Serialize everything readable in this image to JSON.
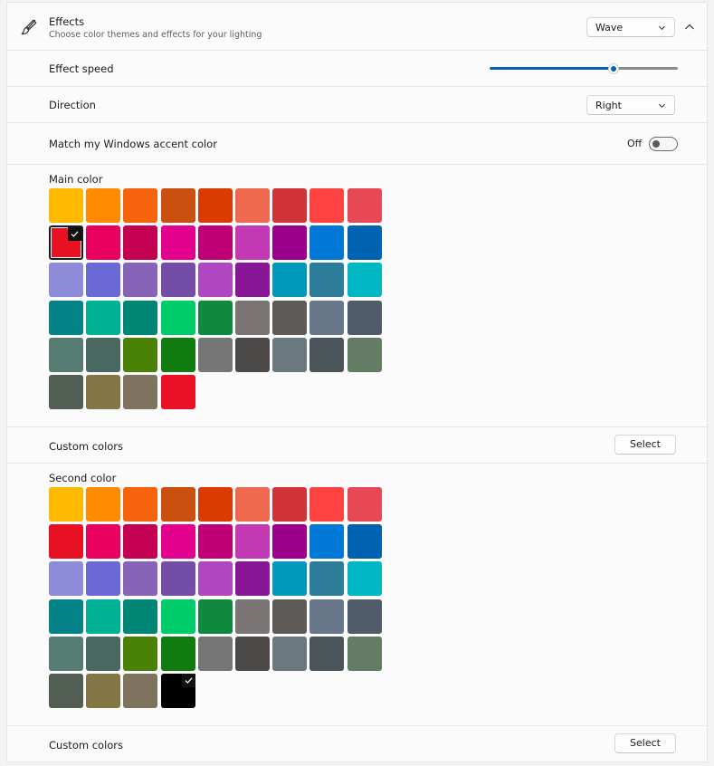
{
  "effects": {
    "title": "Effects",
    "subtitle": "Choose color themes and effects for your lighting",
    "icon": "brush-icon",
    "selected_effect": "Wave"
  },
  "effect_speed": {
    "label": "Effect speed",
    "value": 0.66,
    "accent": "#0a5fb3"
  },
  "direction": {
    "label": "Direction",
    "value": "Right"
  },
  "accent_match": {
    "label": "Match my Windows accent color",
    "state_text": "Off",
    "on": false
  },
  "main_color": {
    "label": "Main color",
    "selected_index": 9,
    "colors": [
      "#ffb900",
      "#ff8c00",
      "#f7630c",
      "#ca5010",
      "#da3b01",
      "#ef6950",
      "#d13438",
      "#ff4343",
      "#e74856",
      "#e81123",
      "#ea005e",
      "#c30052",
      "#e3008c",
      "#bf0077",
      "#c239b3",
      "#9a0089",
      "#0078d7",
      "#0063b1",
      "#8e8cd8",
      "#6b69d6",
      "#8764b8",
      "#744da9",
      "#b146c2",
      "#881798",
      "#0099bc",
      "#2d7d9a",
      "#00b7c3",
      "#038387",
      "#00b294",
      "#018574",
      "#00cc6a",
      "#10893e",
      "#7a7574",
      "#5d5a58",
      "#68768a",
      "#515c6b",
      "#567c73",
      "#486860",
      "#498205",
      "#107c10",
      "#767676",
      "#4c4a48",
      "#69797e",
      "#4a5459",
      "#647c64",
      "#525e54",
      "#847545",
      "#7e735f",
      "#ea1126"
    ]
  },
  "main_custom": {
    "label": "Custom colors",
    "button": "Select"
  },
  "second_color": {
    "label": "Second color",
    "selected_index": 48,
    "colors": [
      "#ffb900",
      "#ff8c00",
      "#f7630c",
      "#ca5010",
      "#da3b01",
      "#ef6950",
      "#d13438",
      "#ff4343",
      "#e74856",
      "#e81123",
      "#ea005e",
      "#c30052",
      "#e3008c",
      "#bf0077",
      "#c239b3",
      "#9a0089",
      "#0078d7",
      "#0063b1",
      "#8e8cd8",
      "#6b69d6",
      "#8764b8",
      "#744da9",
      "#b146c2",
      "#881798",
      "#0099bc",
      "#2d7d9a",
      "#00b7c3",
      "#038387",
      "#00b294",
      "#018574",
      "#00cc6a",
      "#10893e",
      "#7a7574",
      "#5d5a58",
      "#68768a",
      "#515c6b",
      "#567c73",
      "#486860",
      "#498205",
      "#107c10",
      "#767676",
      "#4c4a48",
      "#69797e",
      "#4a5459",
      "#647c64",
      "#525e54",
      "#847545",
      "#7e735f",
      "#000000"
    ]
  },
  "second_custom": {
    "label": "Custom colors",
    "button": "Select"
  }
}
